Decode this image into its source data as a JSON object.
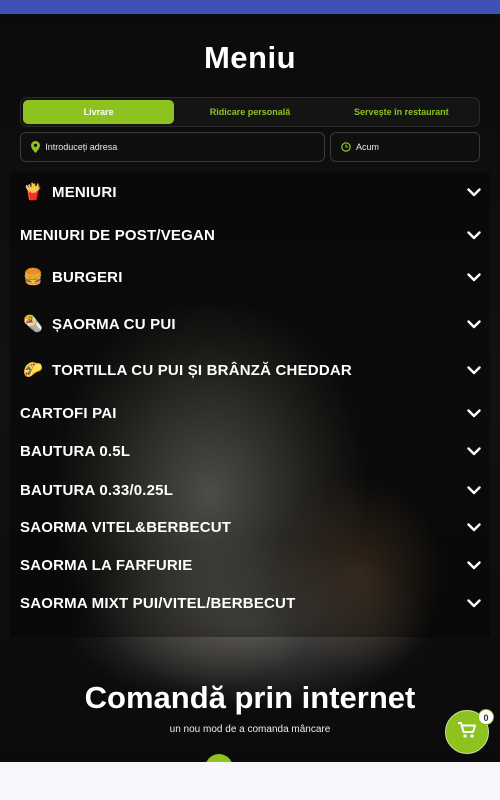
{
  "page": {
    "title": "Meniu"
  },
  "tabs": [
    {
      "label": "Livrare",
      "active": true
    },
    {
      "label": "Ridicare personală",
      "active": false
    },
    {
      "label": "Servește în restaurant",
      "active": false
    }
  ],
  "address": {
    "placeholder": "Introduceți adresa",
    "icon": "location-pin-icon"
  },
  "time": {
    "value": "Acum",
    "icon": "clock-icon"
  },
  "menu": [
    {
      "label": "MENIURI",
      "emoji": "🍟"
    },
    {
      "label": "MENIURI DE POST/VEGAN",
      "emoji": ""
    },
    {
      "label": "BURGERI",
      "emoji": "🍔"
    },
    {
      "label": "ȘAORMA CU PUI",
      "emoji": "🌯"
    },
    {
      "label": "TORTILLA CU PUI ȘI BRÂNZĂ CHEDDAR",
      "emoji": "🌮"
    },
    {
      "label": "CARTOFI PAI",
      "emoji": ""
    },
    {
      "label": "BAUTURA 0.5L",
      "emoji": ""
    },
    {
      "label": "BAUTURA 0.33/0.25L",
      "emoji": ""
    },
    {
      "label": "SAORMA VITEL&BERBECUT",
      "emoji": ""
    },
    {
      "label": "SAORMA LA FARFURIE",
      "emoji": ""
    },
    {
      "label": "SAORMA MIXT PUI/VITEL/BERBECUT",
      "emoji": ""
    }
  ],
  "footer": {
    "title": "Comandă prin internet",
    "subtitle": "un nou mod de a comanda mâncare"
  },
  "cart": {
    "count": "0",
    "icon": "cart-icon"
  },
  "colors": {
    "accent": "#8dc21f",
    "status_bar": "#3f51b5"
  }
}
